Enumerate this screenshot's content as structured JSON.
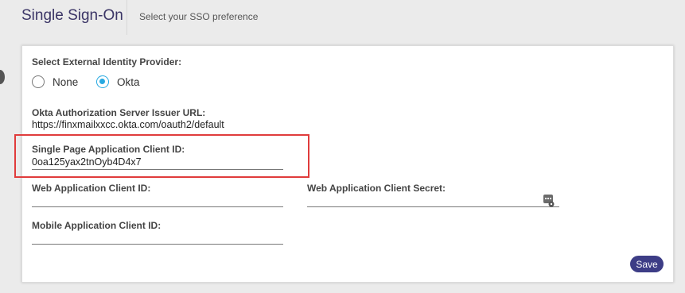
{
  "header": {
    "title": "Single Sign-On",
    "subtitle": "Select your SSO preference"
  },
  "form": {
    "idp_label": "Select External Identity Provider:",
    "idp_options": [
      {
        "label": "None",
        "selected": false
      },
      {
        "label": "Okta",
        "selected": true
      }
    ],
    "issuer_label": "Okta Authorization Server Issuer URL:",
    "issuer_value": "https://finxmailxxcc.okta.com/oauth2/default",
    "spa_label": "Single Page Application Client ID:",
    "spa_value": "0oa125yax2tnOyb4D4x7",
    "web_id_label": "Web Application Client ID:",
    "web_id_value": "",
    "web_secret_label": "Web Application Client Secret:",
    "web_secret_value": "",
    "mobile_label": "Mobile Application Client ID:",
    "mobile_value": "",
    "save_label": "Save"
  },
  "colors": {
    "accent": "#27a9e1",
    "button": "#3d3d86",
    "highlight": "#e03c3c",
    "title": "#3b3566"
  },
  "icons": {
    "secret_toggle": "key-icon"
  }
}
